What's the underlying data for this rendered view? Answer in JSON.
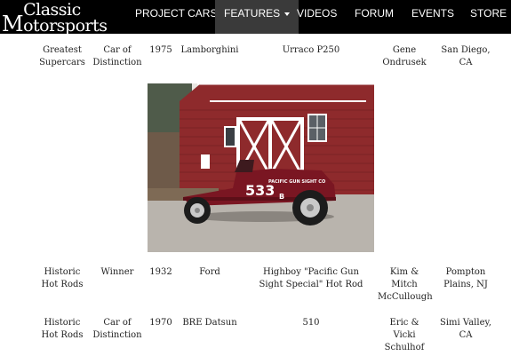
{
  "nav": {
    "logo_line1": "Classic",
    "logo_line2": "otorsports",
    "logo_m": "M",
    "items": [
      {
        "label": "PROJECT CARS"
      },
      {
        "label": "FEATURES"
      },
      {
        "label": "VIDEOS"
      },
      {
        "label": "FORUM"
      },
      {
        "label": "EVENTS"
      },
      {
        "label": "STORE"
      }
    ]
  },
  "rows": [
    {
      "category": "Greatest Supercars",
      "award": "Car of Distinction",
      "year": "1975",
      "make": "Lamborghini",
      "model": "Urraco P250",
      "owner": "Gene Ondrusek",
      "location": "San Diego, CA"
    },
    {
      "category": "Historic Hot Rods",
      "award": "Winner",
      "year": "1932",
      "make": "Ford",
      "model": "Highboy \"Pacific Gun Sight Special\" Hot Rod",
      "owner": "Kim & Mitch McCullough",
      "location": "Pompton Plains, NJ"
    },
    {
      "category": "Historic Hot Rods",
      "award": "Car of Distinction",
      "year": "1970",
      "make": "BRE Datsun",
      "model": "510",
      "owner": "Eric & Vicki Schulhof",
      "location": "Simi Valley, CA"
    }
  ],
  "photo": {
    "car_number": "533",
    "car_class": "B",
    "car_lettering": "PACIFIC GUN SIGHT CO",
    "colors": {
      "barn": "#8e2a2c",
      "car": "#7a1622",
      "ground": "#b9b4ad"
    }
  }
}
